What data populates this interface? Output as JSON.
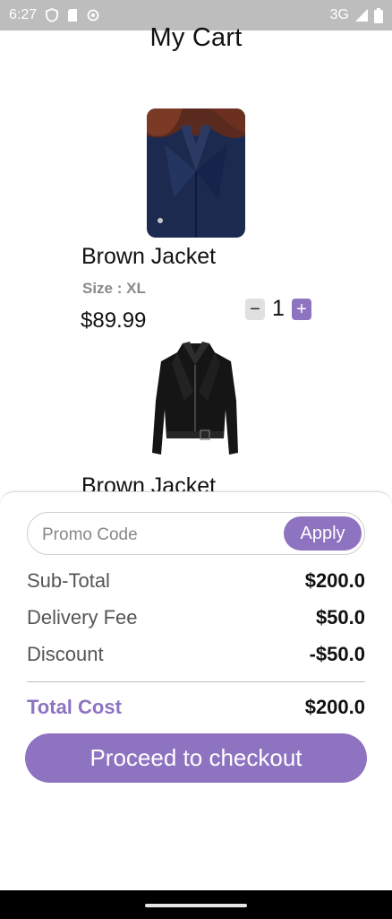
{
  "status_bar": {
    "time": "6:27",
    "network": "3G",
    "icons": [
      "shield-icon",
      "sim-card-icon",
      "notification-icon",
      "signal-icon",
      "battery-icon"
    ]
  },
  "header": {
    "title": "My Cart"
  },
  "cart": {
    "items": [
      {
        "name": "Brown Jacket",
        "size": "Size : XL",
        "price": "$89.99",
        "quantity": "1",
        "image": "navy-coat-image"
      },
      {
        "name": "Brown Jacket",
        "image": "black-leather-jacket-image"
      }
    ]
  },
  "summary": {
    "promo_placeholder": "Promo Code",
    "apply_label": "Apply",
    "subtotal_label": "Sub-Total",
    "subtotal_value": "$200.0",
    "delivery_label": "Delivery Fee",
    "delivery_value": "$50.0",
    "discount_label": "Discount",
    "discount_value": "-$50.0",
    "total_label": "Total Cost",
    "total_value": "$200.0",
    "checkout_label": "Proceed to checkout"
  },
  "colors": {
    "accent": "#8e73c1",
    "status_bar": "#bdbdbd"
  }
}
